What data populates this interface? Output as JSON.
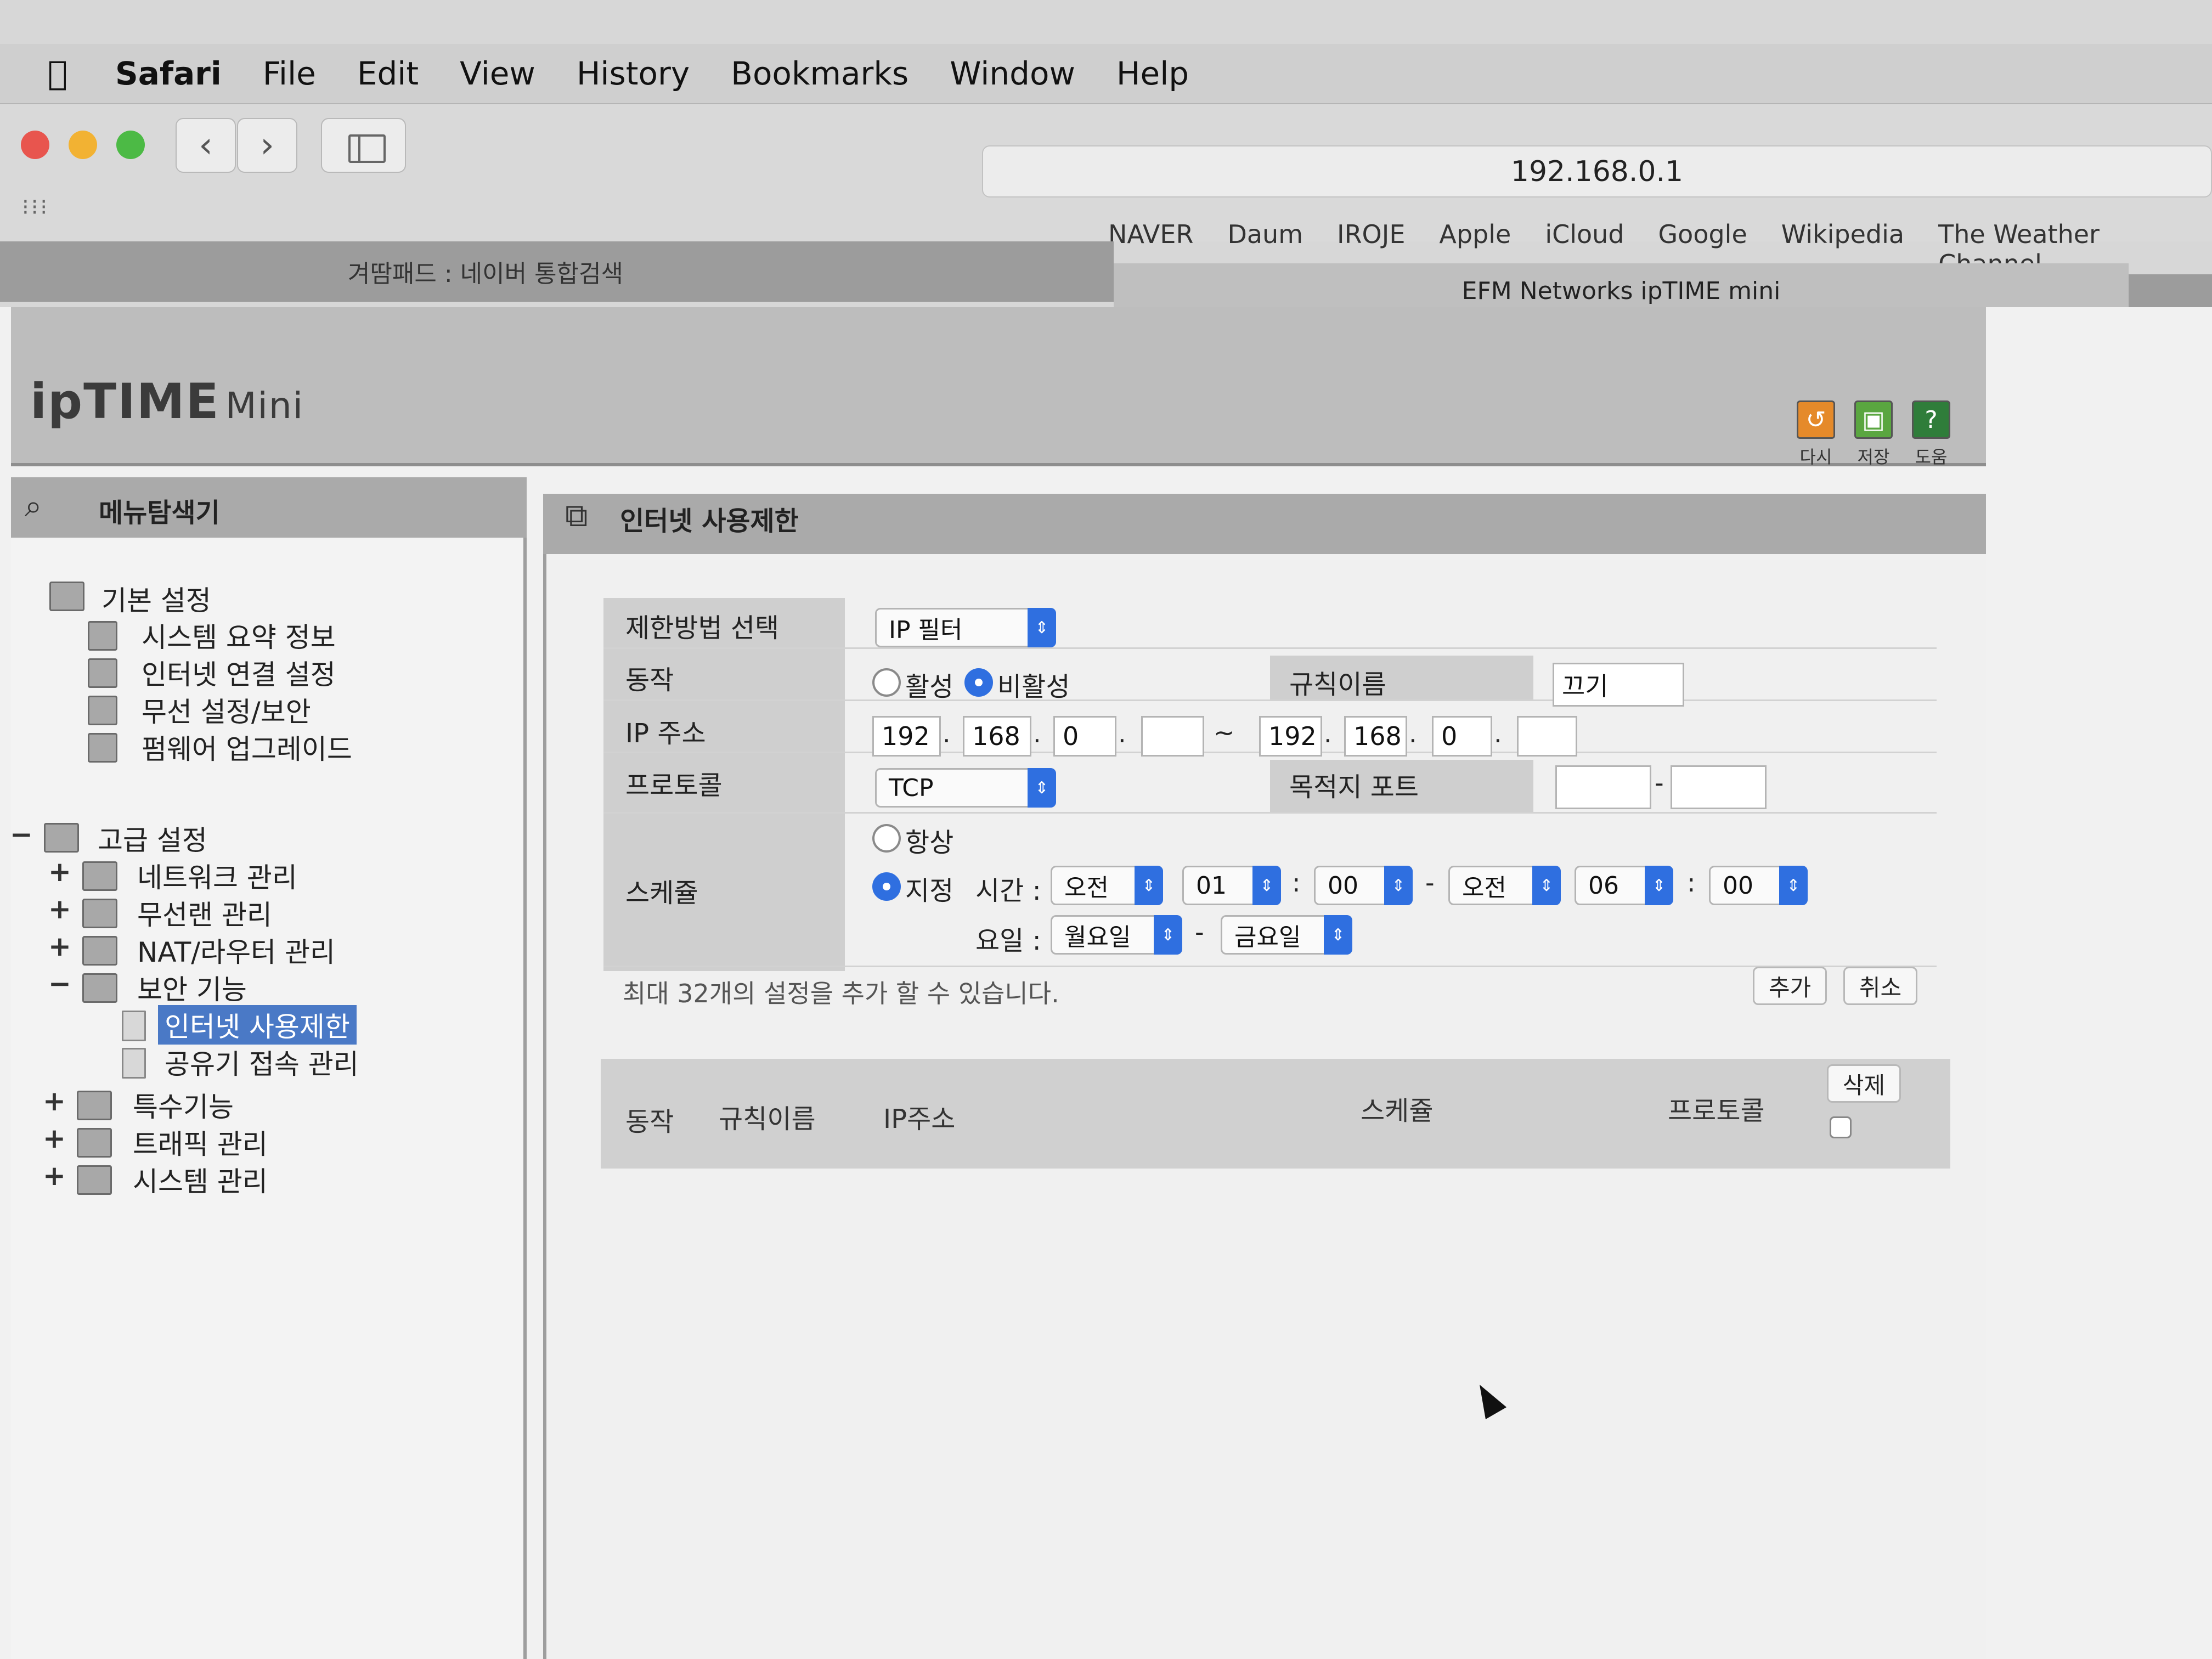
{
  "menubar": {
    "apple": "",
    "app": "Safari",
    "items": [
      "File",
      "Edit",
      "View",
      "History",
      "Bookmarks",
      "Window",
      "Help"
    ]
  },
  "toolbar": {
    "back": "‹",
    "forward": "›",
    "url": "192.168.0.1",
    "favorites": [
      "NAVER",
      "Daum",
      "IROJE",
      "Apple",
      "iCloud",
      "Google",
      "Wikipedia",
      "The Weather Channel"
    ]
  },
  "tabs": [
    "겨땀패드 : 네이버 통합검색",
    "EFM Networks ipTIME mini"
  ],
  "header": {
    "logo_main": "ipTIME",
    "logo_sub": "Mini",
    "actions": [
      "다시",
      "저장",
      "도움"
    ]
  },
  "left_menu": {
    "title": "메뉴탐색기",
    "basic": {
      "label": "기본 설정",
      "items": [
        "시스템 요약 정보",
        "인터넷 연결 설정",
        "무선 설정/보안",
        "펌웨어 업그레이드"
      ]
    },
    "advanced": {
      "toggle": "−",
      "label": "고급 설정",
      "groups": [
        {
          "toggle": "+",
          "label": "네트워크 관리"
        },
        {
          "toggle": "+",
          "label": "무선랜 관리"
        },
        {
          "toggle": "+",
          "label": "NAT/라우터 관리"
        },
        {
          "toggle": "−",
          "label": "보안 기능"
        }
      ],
      "security_items": [
        "인터넷 사용제한",
        "공유기 접속 관리"
      ],
      "more_groups": [
        {
          "toggle": "+",
          "label": "특수기능"
        },
        {
          "toggle": "+",
          "label": "트래픽 관리"
        },
        {
          "toggle": "+",
          "label": "시스템 관리"
        }
      ]
    }
  },
  "main": {
    "title": "인터넷 사용제한",
    "form": {
      "method_label": "제한방법 선택",
      "method_value": "IP 필터",
      "action_label": "동작",
      "action_on": "활성",
      "action_off": "비활성",
      "action_selected": "비활성",
      "rule_name_label": "규칙이름",
      "rule_name_value": "끄기",
      "ip_label": "IP 주소",
      "ip_from": [
        "192",
        "168",
        "0",
        ""
      ],
      "ip_to": [
        "192",
        "168",
        "0",
        ""
      ],
      "ip_range_sep": "~",
      "protocol_label": "프로토콜",
      "protocol_value": "TCP",
      "dest_port_label": "목적지 포트",
      "dest_port_from": "",
      "dest_port_to": "",
      "schedule_label": "스케쥴",
      "schedule_always": "항상",
      "schedule_custom": "지정",
      "schedule_selected": "지정",
      "time_label": "시간 :",
      "start_ampm": "오전",
      "start_hour": "01",
      "start_min": "00",
      "end_ampm": "오전",
      "end_hour": "06",
      "end_min": "00",
      "day_label": "요일 :",
      "day_from": "월요일",
      "day_to": "금요일",
      "note": "최대 32개의 설정을 추가 할 수 있습니다.",
      "add_button": "추가",
      "cancel_button": "취소"
    },
    "table": {
      "columns": [
        "동작",
        "규칙이름",
        "IP주소",
        "스케쥴",
        "프로토콜"
      ],
      "delete_button": "삭제",
      "rows": []
    }
  }
}
